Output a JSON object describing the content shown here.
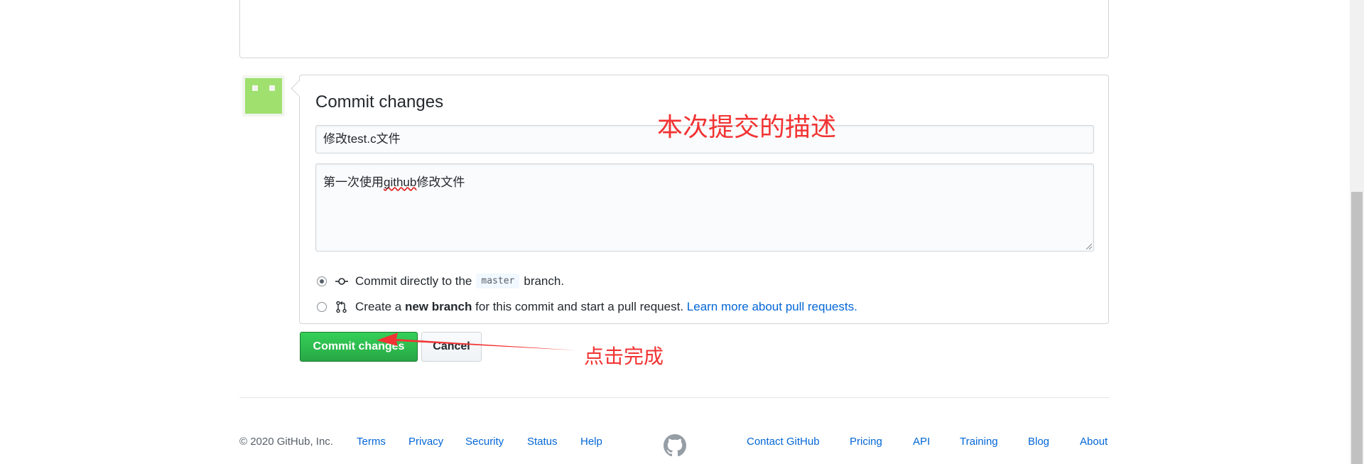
{
  "commit_panel": {
    "title": "Commit changes",
    "summary_value": "修改test.c文件",
    "description_prefix": "第一次使用",
    "description_misspelled": "github",
    "description_suffix": "修改文件",
    "options": [
      {
        "prefix": "Commit directly to the",
        "branch": "master",
        "suffix": "branch.",
        "selected": true,
        "icon": "git-commit-icon"
      },
      {
        "prefix": "Create a",
        "bold": "new branch",
        "suffix": "for this commit and start a pull request.",
        "link": "Learn more about pull requests.",
        "selected": false,
        "icon": "git-pull-request-icon"
      }
    ]
  },
  "buttons": {
    "commit": "Commit changes",
    "cancel": "Cancel"
  },
  "annotations": {
    "description_note": "本次提交的描述",
    "click_note": "点击完成",
    "color": "#f23333"
  },
  "footer": {
    "copyright": "© 2020 GitHub, Inc.",
    "left_links": [
      "Terms",
      "Privacy",
      "Security",
      "Status",
      "Help"
    ],
    "right_links": [
      "Contact GitHub",
      "Pricing",
      "API",
      "Training",
      "Blog",
      "About"
    ]
  },
  "colors": {
    "primary_button": "#28a745",
    "link": "#0366d6",
    "avatar": "#9fe06f"
  }
}
